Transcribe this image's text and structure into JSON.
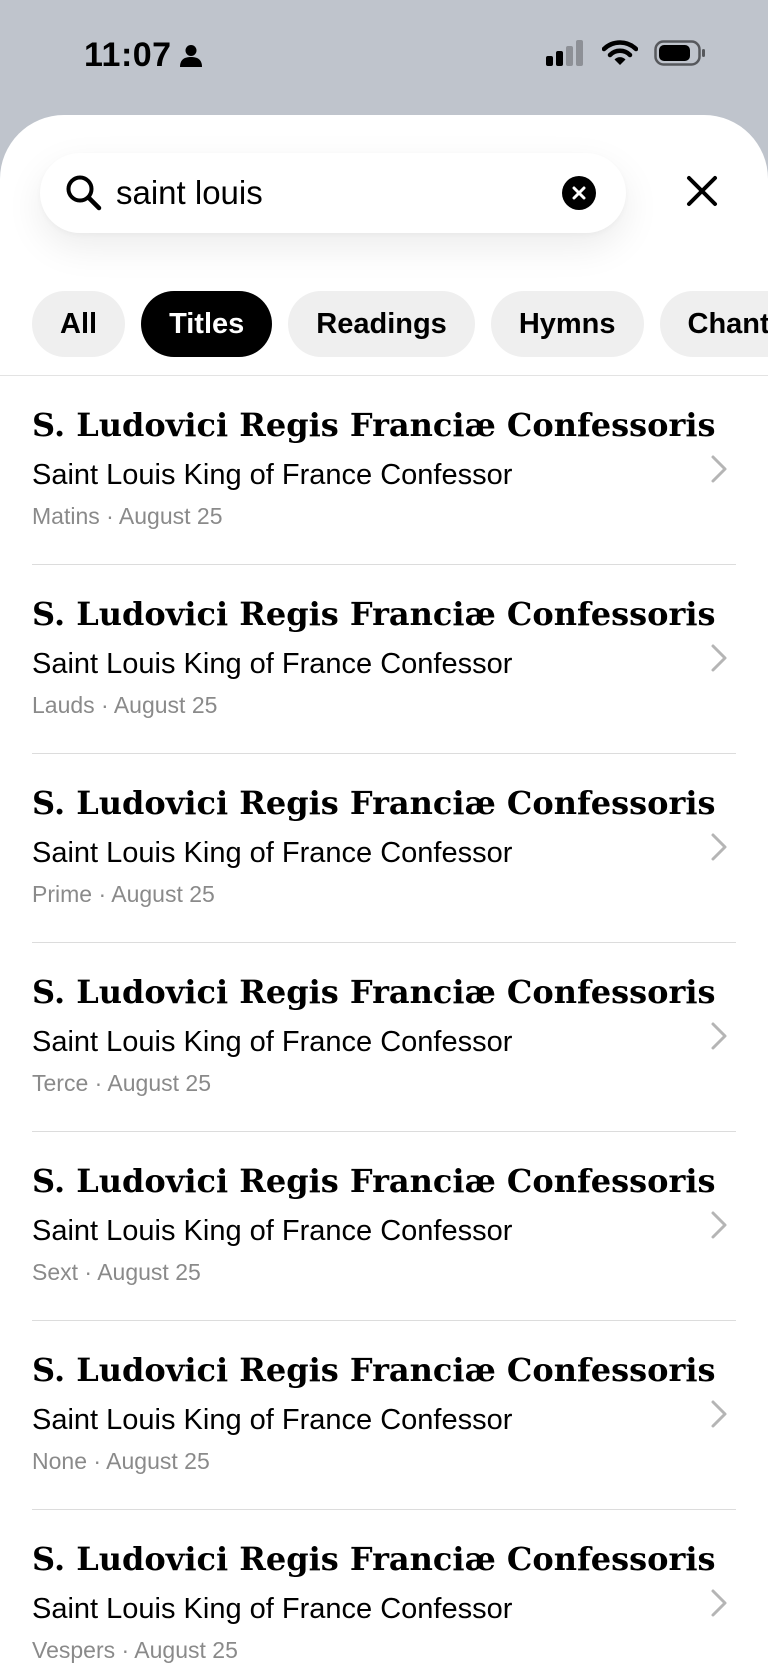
{
  "status_bar": {
    "time": "11:07"
  },
  "search": {
    "query": "saint louis",
    "placeholder": ""
  },
  "filters": [
    "All",
    "Titles",
    "Readings",
    "Hymns",
    "Chants"
  ],
  "active_filter": "Titles",
  "results": [
    {
      "latin": "S. Ludovici Regis Franciæ Confessoris",
      "english": "Saint Louis King of France Confessor",
      "meta": "Matins · August 25"
    },
    {
      "latin": "S. Ludovici Regis Franciæ Confessoris",
      "english": "Saint Louis King of France Confessor",
      "meta": "Lauds · August 25"
    },
    {
      "latin": "S. Ludovici Regis Franciæ Confessoris",
      "english": "Saint Louis King of France Confessor",
      "meta": "Prime · August 25"
    },
    {
      "latin": "S. Ludovici Regis Franciæ Confessoris",
      "english": "Saint Louis King of France Confessor",
      "meta": "Terce · August 25"
    },
    {
      "latin": "S. Ludovici Regis Franciæ Confessoris",
      "english": "Saint Louis King of France Confessor",
      "meta": "Sext · August 25"
    },
    {
      "latin": "S. Ludovici Regis Franciæ Confessoris",
      "english": "Saint Louis King of France Confessor",
      "meta": "None · August 25"
    },
    {
      "latin": "S. Ludovici Regis Franciæ Confessoris",
      "english": "Saint Louis King of France Confessor",
      "meta": "Vespers · August 25"
    }
  ],
  "icons": {
    "search": "search-icon",
    "clear": "clear-icon",
    "close": "close-icon",
    "chevron": "chevron-right-icon",
    "person": "person-icon",
    "signal": "signal-icon",
    "wifi": "wifi-icon",
    "battery": "battery-icon"
  },
  "colors": {
    "active_chip": "#000000",
    "chip": "#efefef",
    "meta_text": "#8a8a8a",
    "status_bar_bg": "#bfc4cc"
  }
}
